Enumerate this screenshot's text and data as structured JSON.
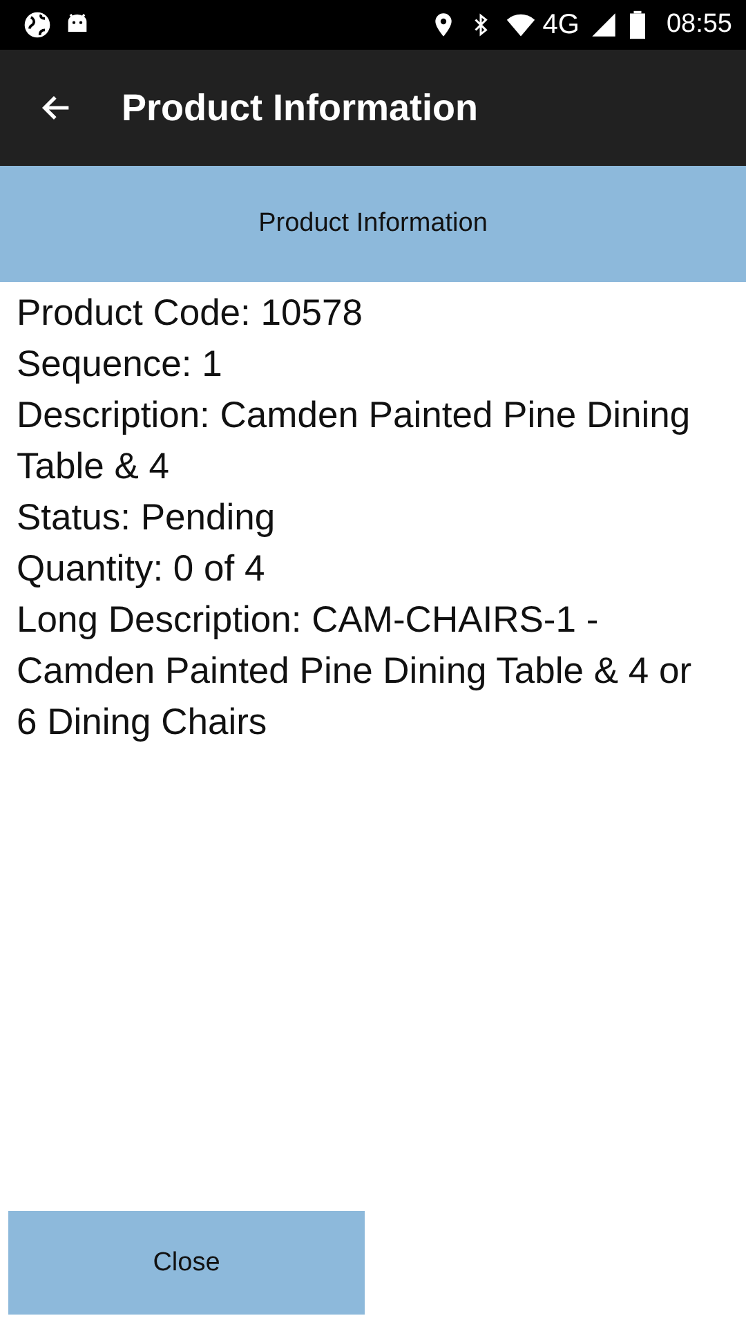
{
  "status_bar": {
    "network": "4G",
    "time": "08:55"
  },
  "app_bar": {
    "title": "Product Information"
  },
  "section_header": "Product Information",
  "details": [
    "Product Code: 10578",
    "Sequence: 1",
    "Description: Camden Painted Pine Dining Table & 4",
    "Status: Pending",
    "Quantity: 0 of 4",
    "Long Description: CAM-CHAIRS-1 - Camden Painted Pine Dining Table & 4 or 6 Dining Chairs"
  ],
  "buttons": [
    "Close"
  ]
}
